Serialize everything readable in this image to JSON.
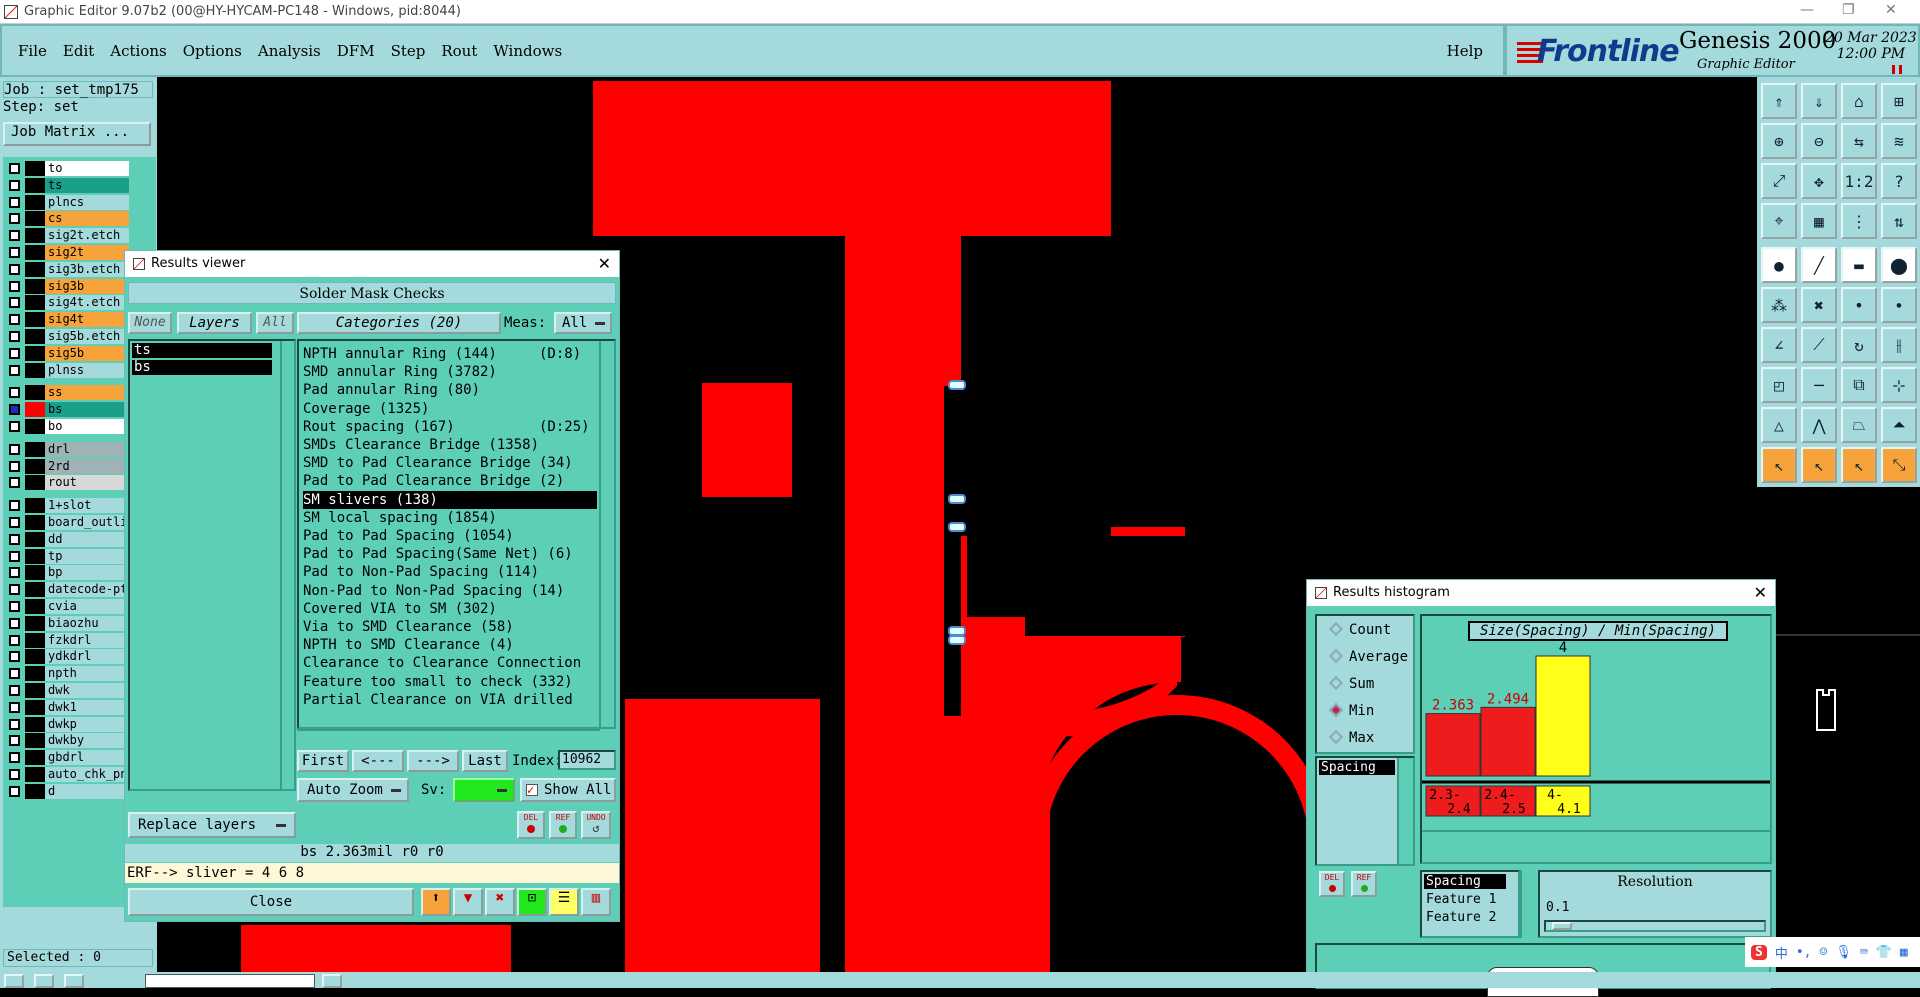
{
  "window": {
    "title": "Graphic Editor 9.07b2 (00@HY-HYCAM-PC148 - Windows, pid:8044)"
  },
  "menu": {
    "items": [
      "File",
      "Edit",
      "Actions",
      "Options",
      "Analysis",
      "DFM",
      "Step",
      "Rout",
      "Windows"
    ],
    "help": "Help"
  },
  "branding": {
    "company": "Frontline",
    "product": "Genesis 2000",
    "subtitle": "Graphic Editor",
    "date": "20 Mar 2023",
    "time": "12:00 PM"
  },
  "job_panel": {
    "job": "Job : set_tmp175",
    "step": "Step: set",
    "job_matrix": "Job Matrix ...",
    "selected": "Selected : 0",
    "layers": [
      {
        "name": "to",
        "bg": "#ffffff"
      },
      {
        "name": "ts",
        "bg": "#1aa08a"
      },
      {
        "name": "plncs",
        "bg": "#a4dadb"
      },
      {
        "name": "cs",
        "bg": "#f6a33b"
      },
      {
        "name": "sig2t.etch",
        "bg": "#a4dadb"
      },
      {
        "name": "sig2t",
        "bg": "#f6a33b"
      },
      {
        "name": "sig3b.etch",
        "bg": "#a4dadb"
      },
      {
        "name": "sig3b",
        "bg": "#f6a33b"
      },
      {
        "name": "sig4t.etch",
        "bg": "#a4dadb"
      },
      {
        "name": "sig4t",
        "bg": "#f6a33b"
      },
      {
        "name": "sig5b.etch",
        "bg": "#a4dadb"
      },
      {
        "name": "sig5b",
        "bg": "#f6a33b"
      },
      {
        "name": "plnss",
        "bg": "#a4dadb"
      },
      {
        "name": "ss",
        "bg": "#f6a33b"
      },
      {
        "name": "bs",
        "bg": "#1aa08a"
      },
      {
        "name": "bo",
        "bg": "#ffffff"
      },
      {
        "name": "drl",
        "bg": "#9fb3b6"
      },
      {
        "name": "2rd",
        "bg": "#9fb3b6"
      },
      {
        "name": "rout",
        "bg": "#d8d8d8"
      },
      {
        "name": "1+slot",
        "bg": "#a4dadb"
      },
      {
        "name": "board_outline",
        "bg": "#a4dadb"
      },
      {
        "name": "dd",
        "bg": "#a4dadb"
      },
      {
        "name": "tp",
        "bg": "#a4dadb"
      },
      {
        "name": "bp",
        "bg": "#a4dadb"
      },
      {
        "name": "datecode-pt",
        "bg": "#a4dadb"
      },
      {
        "name": "cvia",
        "bg": "#a4dadb"
      },
      {
        "name": "biaozhu",
        "bg": "#a4dadb"
      },
      {
        "name": "fzkdrl",
        "bg": "#a4dadb"
      },
      {
        "name": "ydkdrl",
        "bg": "#a4dadb"
      },
      {
        "name": "npth",
        "bg": "#a4dadb"
      },
      {
        "name": "dwk",
        "bg": "#a4dadb"
      },
      {
        "name": "dwk1",
        "bg": "#a4dadb"
      },
      {
        "name": "dwkp",
        "bg": "#a4dadb"
      },
      {
        "name": "dwkby",
        "bg": "#a4dadb"
      },
      {
        "name": "gbdrl",
        "bg": "#a4dadb"
      },
      {
        "name": "auto_chk_pn",
        "bg": "#a4dadb"
      },
      {
        "name": "d",
        "bg": "#a4dadb"
      }
    ]
  },
  "results_viewer": {
    "title": "Results viewer",
    "section": "Solder Mask Checks",
    "btn_none": "None",
    "btn_layers": "Layers",
    "btn_all": "All",
    "categories_label": "Categories (20)",
    "meas_label": "Meas:",
    "meas_value": "All",
    "layers": [
      "ts",
      "bs"
    ],
    "categories": [
      "NPTH annular Ring (144)     (D:8)",
      "SMD annular Ring (3782)",
      "Pad annular Ring (80)",
      "Coverage (1325)",
      "Rout spacing (167)          (D:25)",
      "SMDs Clearance Bridge (1358)",
      "SMD to Pad Clearance Bridge (34)",
      "Pad to Pad Clearance Bridge (2)",
      "SM slivers (138)",
      "SM local spacing (1854)",
      "Pad to Pad Spacing (1054)",
      "Pad to Pad Spacing(Same Net) (6)",
      "Pad to Non-Pad Spacing (114)",
      "Non-Pad to Non-Pad Spacing (14)",
      "Covered VIA to SM (302)",
      "Via to SMD Clearance (58)",
      "NPTH to SMD Clearance (4)",
      "Clearance to Clearance Connection",
      "Feature too small to check (332)",
      "Partial Clearance on VIA drilled"
    ],
    "selected_index": 8,
    "nav": {
      "first": "First",
      "prev": "<---",
      "next": "--->",
      "last": "Last",
      "index_label": "Index:",
      "index_value": "10962"
    },
    "auto_zoom": "Auto Zoom",
    "sv_label": "Sv:",
    "show_all": "Show All",
    "replace_layers": "Replace layers",
    "icon_labels": [
      "DEL",
      "REF",
      "UNDO"
    ],
    "status": "bs 2.363mil  r0  r0",
    "erf": "ERF--> sliver = 4 6 8",
    "close": "Close"
  },
  "histogram": {
    "title": "Results histogram",
    "radios": [
      {
        "label": "Count",
        "on": false
      },
      {
        "label": "Average",
        "on": false
      },
      {
        "label": "Sum",
        "on": false
      },
      {
        "label": "Min",
        "on": true
      },
      {
        "label": "Max",
        "on": false
      }
    ],
    "spacing_tag": "Spacing",
    "chart_title": "Size(Spacing) / Min(Spacing)",
    "bars": [
      {
        "range_top": "2.3-",
        "range_bot": "2.4",
        "value": 2.363,
        "label": "2.363",
        "color": "#ee1c1c"
      },
      {
        "range_top": "2.4-",
        "range_bot": "2.5",
        "value": 2.494,
        "label": "2.494",
        "color": "#ee1c1c"
      },
      {
        "range_top": "4-",
        "range_bot": "4.1",
        "value": 4,
        "label": "4",
        "color": "#ffff1a"
      }
    ],
    "ymax": 4,
    "list": [
      "Spacing",
      "Feature 1",
      "Feature 2"
    ],
    "resolution_label": "Resolution",
    "resolution_value": "0.1",
    "icon_labels": [
      "DEL",
      "REF"
    ]
  },
  "colors": {
    "panel": "#a4dadb",
    "panel_dark": "#5ccfb6",
    "feature_red": "#ff0000"
  }
}
